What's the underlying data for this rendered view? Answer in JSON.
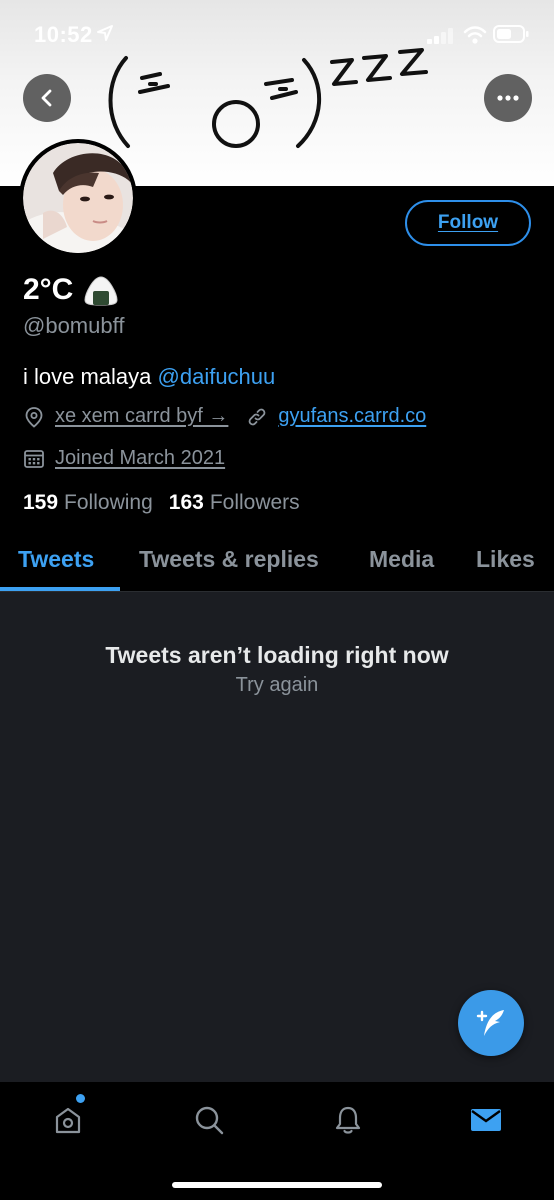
{
  "status_bar": {
    "time": "10:52"
  },
  "header": {
    "back_icon": "chevron-left-icon",
    "more_icon": "more-horizontal-icon"
  },
  "profile": {
    "display_name": "2°C",
    "name_emoji": "onigiri",
    "handle": "@bomubff",
    "bio_text": "i love malaya ",
    "bio_mention": "@daifuchuu",
    "location": "xe xem carrd byf →",
    "website": "gyufans.carrd.co",
    "joined": "Joined March 2021",
    "following_count": "159",
    "following_label": "Following",
    "followers_count": "163",
    "followers_label": "Followers",
    "follow_label": "Follow"
  },
  "tabs": [
    {
      "label": "Tweets",
      "active": true
    },
    {
      "label": "Tweets & replies",
      "active": false
    },
    {
      "label": "Media",
      "active": false
    },
    {
      "label": "Likes",
      "active": false
    }
  ],
  "content": {
    "error_title": "Tweets aren’t loading right now",
    "retry_label": "Try again"
  },
  "colors": {
    "accent": "#3da1f2",
    "background": "#000000",
    "content_bg": "#1b1d22",
    "muted": "#8b939b"
  },
  "bottom_nav": [
    "home-icon",
    "search-icon",
    "notifications-icon",
    "messages-icon"
  ]
}
